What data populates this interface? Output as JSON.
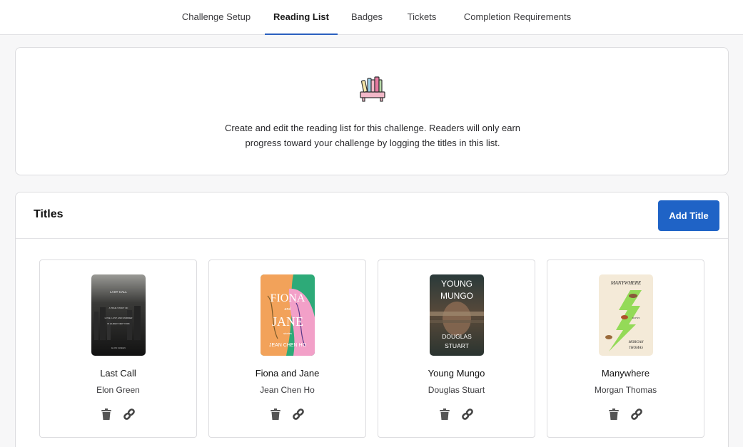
{
  "nav": {
    "tabs": [
      {
        "label": "Challenge Setup",
        "active": false
      },
      {
        "label": "Reading List",
        "active": true
      },
      {
        "label": "Badges",
        "active": false
      },
      {
        "label": "Tickets",
        "active": false
      },
      {
        "label": "Completion Requirements",
        "active": false
      }
    ]
  },
  "intro": {
    "icon": "bookshelf-icon",
    "text_line1": "Create and edit the reading list for this challenge. Readers will only earn",
    "text_line2": "progress toward your challenge by logging the titles in this list."
  },
  "titles": {
    "heading": "Titles",
    "add_button": "Add Title",
    "books": [
      {
        "title": "Last Call",
        "author": "Elon Green"
      },
      {
        "title": "Fiona and Jane",
        "author": "Jean Chen Ho"
      },
      {
        "title": "Young Mungo",
        "author": "Douglas Stuart"
      },
      {
        "title": "Manywhere",
        "author": "Morgan Thomas"
      }
    ],
    "covers": {
      "last_call": {
        "line1": "LAST CALL",
        "line2": "A TRUE STORY OF",
        "line3": "LOVE, LUST, AND MURDER",
        "line4": "IN QUEER NEW YORK",
        "line5": "ELON GREEN"
      },
      "fiona": {
        "word1": "FIONA",
        "word2": "and",
        "word3": "JANE",
        "word4": "stories",
        "word5": "JEAN CHEN HO"
      },
      "mungo": {
        "word1": "YOUNG",
        "word2": "MUNGO",
        "word3": "DOUGLAS",
        "word4": "STUART"
      },
      "manywhere": {
        "word1": "MANYWHERE",
        "word2": "stories",
        "word3": "MORGAN",
        "word4": "THOMAS"
      }
    },
    "action_icons": [
      "trash-icon",
      "link-icon"
    ]
  },
  "colors": {
    "accent": "#1f63c6",
    "active_tab_underline": "#2a5fbf"
  }
}
